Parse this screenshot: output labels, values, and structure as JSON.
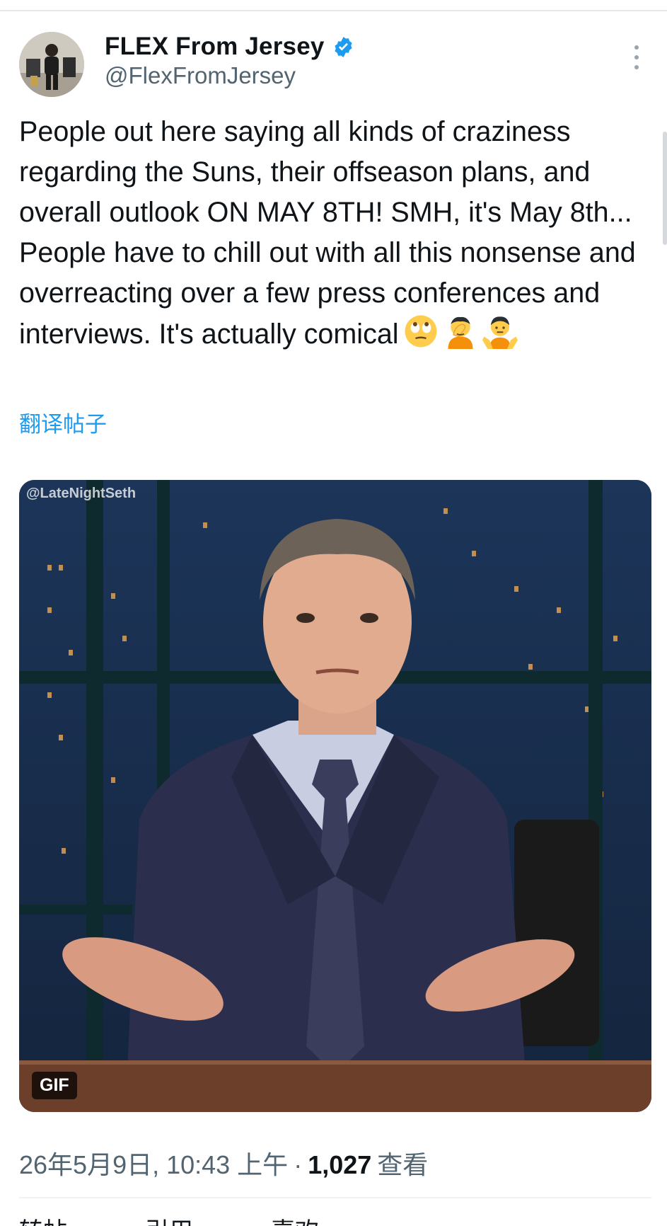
{
  "colors": {
    "accent": "#1d9bf0",
    "text_primary": "#0f1419",
    "text_secondary": "#536471",
    "divider": "#eff3f4"
  },
  "author": {
    "display_name": "FLEX From Jersey",
    "handle": "@FlexFromJersey",
    "verified_icon": "verified-badge-icon",
    "more_icon": "more-vertical-icon"
  },
  "tweet": {
    "text": "People out here saying all kinds of craziness regarding the Suns, their offseason plans, and overall outlook ON MAY 8TH! SMH, it's May 8th... People have to chill out with all this nonsense and overreacting over a few press conferences and interviews. It's actually comical",
    "emojis": [
      "face-with-rolling-eyes-icon",
      "person-facepalming-icon",
      "person-shrugging-icon"
    ],
    "translate_label": "翻译帖子"
  },
  "media": {
    "watermark": "@LateNightSeth",
    "badge": "GIF"
  },
  "meta": {
    "timestamp": "26年5月9日, 10:43 上午",
    "separator": "·",
    "views_count": "1,027",
    "views_label": "查看"
  },
  "actions_cutoff": [
    "转帖",
    "引用",
    "喜欢"
  ]
}
